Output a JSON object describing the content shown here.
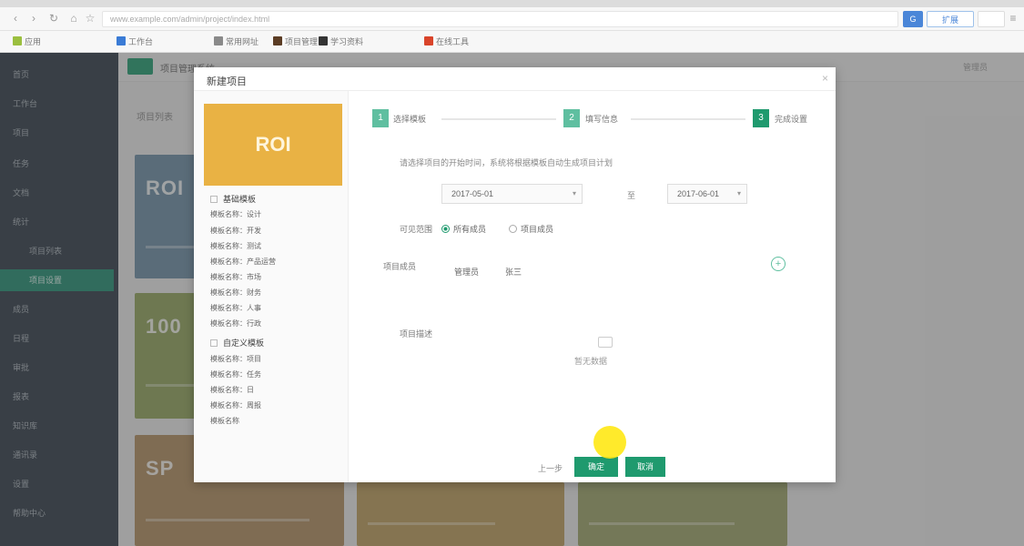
{
  "browser": {
    "url": "www.example.com/admin/project/index.html",
    "ext_button_label": "扩展"
  },
  "bookmarks": [
    "应用",
    "工作台",
    "常用网址",
    "项目管理",
    "学习资料",
    "在线工具"
  ],
  "app": {
    "header_title": "项目管理系统",
    "subtitle": "项目列表",
    "header_right": "管理员",
    "sidebar": [
      "首页",
      "工作台",
      "项目",
      "任务",
      "文档",
      "统计",
      "项目列表",
      "项目设置",
      "成员",
      "日程",
      "审批",
      "报表",
      "知识库",
      "通讯录",
      "设置",
      "帮助中心"
    ],
    "cards": [
      {
        "title": "ROI",
        "color": "#6a8ba3"
      },
      {
        "title": "100",
        "color": "#8ea15a"
      },
      {
        "title": "SP",
        "color": "#ad8a5e"
      },
      {
        "title": "",
        "color": "#b99a5a"
      },
      {
        "title": "",
        "color": "#9aa066"
      }
    ]
  },
  "modal": {
    "title": "新建项目",
    "close": "×",
    "promo_text": "ROI",
    "groups": [
      {
        "label": "基础模板",
        "rows": [
          "模板名称：设计",
          "模板名称：开发",
          "模板名称：测试",
          "模板名称：产品运营",
          "模板名称：市场",
          "模板名称：财务",
          "模板名称：人事",
          "模板名称：行政"
        ]
      },
      {
        "label": "自定义模板",
        "rows": [
          "模板名称：项目",
          "模板名称：任务",
          "模板名称：日",
          "模板名称：周报",
          "模板名称"
        ]
      }
    ],
    "steps": [
      {
        "num": "1",
        "label": "选择模板"
      },
      {
        "num": "2",
        "label": "填写信息"
      },
      {
        "num": "3",
        "label": "完成设置"
      }
    ],
    "instruction": "请选择项目的开始时间，系统将根据模板自动生成项目计划",
    "form": {
      "date_label": "",
      "start_value": "2017-05-01",
      "separator": "至",
      "end_value": "2017-06-01",
      "radio_label": "可见范围",
      "radio_options": [
        "所有成员",
        "项目成员"
      ],
      "members_label": "项目成员",
      "members": [
        "管理员",
        "张三"
      ],
      "desc_label": "项目描述",
      "empty_text": "暂无数据"
    },
    "buttons": {
      "prev": "上一步",
      "confirm": "确定",
      "cancel": "取消"
    }
  }
}
